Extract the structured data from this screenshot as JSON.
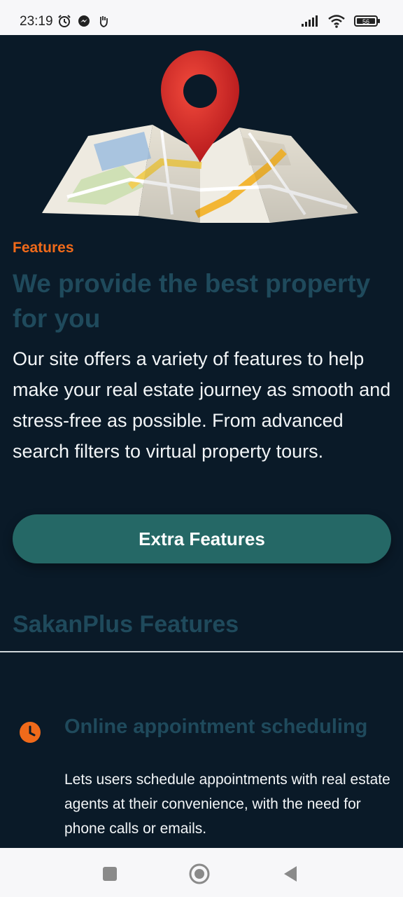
{
  "status_bar": {
    "time": "23:19",
    "left_icons": [
      "alarm-icon",
      "messenger-icon",
      "hand-icon"
    ],
    "right_icons": [
      "signal-icon",
      "wifi-icon",
      "battery-icon"
    ],
    "battery_level": "56"
  },
  "hero": {
    "image": "map-with-location-pin"
  },
  "intro": {
    "kicker": "Features",
    "headline": "We provide the best property for you",
    "description": "Our site offers a variety of features to help make your real estate journey as smooth and stress-free as possible. From advanced search filters to virtual property tours.",
    "button_label": "Extra Features"
  },
  "features_section": {
    "title": "SakanPlus Features",
    "items": [
      {
        "icon": "clock-icon",
        "title": "Online appointment scheduling",
        "description": "Lets users schedule appointments with real estate agents at their convenience, with the need for phone calls or emails."
      }
    ]
  },
  "nav_bar": {
    "buttons": [
      "recents-button",
      "home-button",
      "back-button"
    ]
  },
  "colors": {
    "background": "#0a1a28",
    "accent_orange": "#f06a1a",
    "heading_teal": "#1f4a5c",
    "button_teal": "#256866"
  }
}
